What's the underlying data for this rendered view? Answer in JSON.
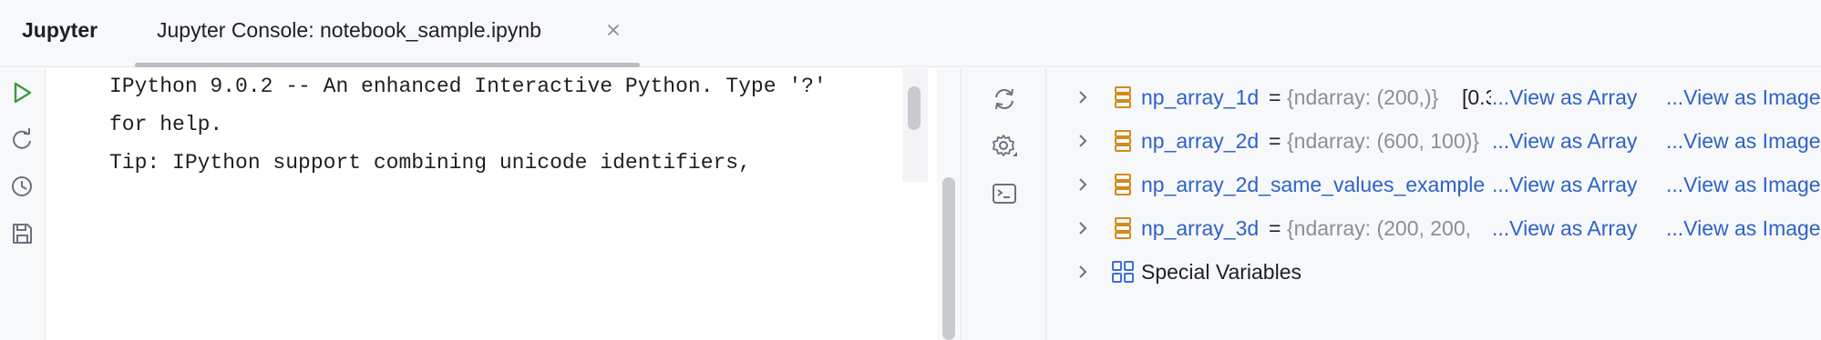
{
  "header": {
    "app_title": "Jupyter",
    "tab_label": "Jupyter Console: notebook_sample.ipynb",
    "tab_close_icon": "close-icon"
  },
  "left_toolbar": {
    "buttons": [
      {
        "icon": "run-icon",
        "color": "#3a9a3a"
      },
      {
        "icon": "restart-icon"
      },
      {
        "icon": "history-icon"
      },
      {
        "icon": "save-icon"
      }
    ]
  },
  "console": {
    "lines": [
      "IPython 9.0.2 -- An enhanced Interactive Python. Type '?'",
      "for help.",
      "Tip: IPython support combining unicode identifiers,"
    ]
  },
  "mid_toolbar": {
    "buttons": [
      {
        "icon": "refresh-icon"
      },
      {
        "icon": "settings-icon"
      },
      {
        "icon": "terminal-icon"
      }
    ]
  },
  "variables": {
    "link_color": "#2e62c9",
    "rows": [
      {
        "name": "np_array_1d",
        "eq": "=",
        "type": "{ndarray: (200,)}",
        "value": "[0.3",
        "view_array": "...View as Array",
        "view_image": "...View as Image"
      },
      {
        "name": "np_array_2d",
        "eq": "=",
        "type": "{ndarray: (600, 100)}",
        "value": "",
        "view_array": "...View as Array",
        "view_image": "...View as Image"
      },
      {
        "name": "np_array_2d_same_values_example",
        "eq": "",
        "type": "",
        "value": "",
        "view_array": "...View as Array",
        "view_image": "...View as Image"
      },
      {
        "name": "np_array_3d",
        "eq": "=",
        "type": "{ndarray: (200, 200,",
        "value": "",
        "view_array": "...View as Array",
        "view_image": "...View as Image"
      }
    ],
    "special": {
      "label": "Special Variables",
      "icon": "grid-icon"
    }
  }
}
